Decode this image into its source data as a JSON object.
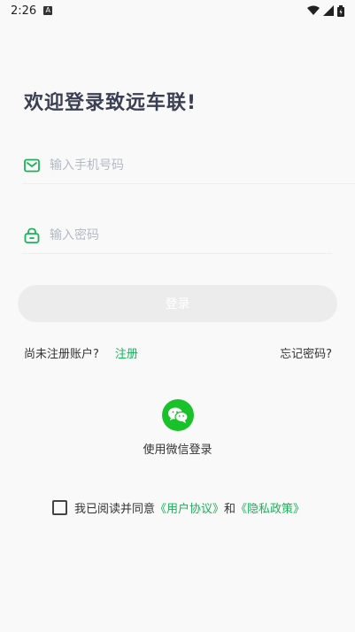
{
  "status_bar": {
    "time": "2:26",
    "notification_glyph": "A",
    "icons": [
      "wifi-icon",
      "signal-icon",
      "battery-icon"
    ]
  },
  "title": "欢迎登录致远车联!",
  "phone": {
    "placeholder": "输入手机号码",
    "value": "",
    "icon": "mail-icon"
  },
  "password": {
    "placeholder": "输入密码",
    "value": "",
    "icon": "lock-icon"
  },
  "login_button": "登录",
  "register": {
    "question": "尚未注册账户?",
    "register_link": "注册",
    "forgot": "忘记密码?"
  },
  "wechat": {
    "label": "使用微信登录",
    "icon": "wechat-icon"
  },
  "agreement": {
    "prefix": "我已阅读并同意",
    "user_agreement": "《用户协议》",
    "and": "和",
    "privacy_policy": "《隐私政策》",
    "checked": false
  },
  "colors": {
    "accent": "#19b35a",
    "wechat": "#19c22a",
    "title": "#3b3f52",
    "button_disabled": "#ececec"
  }
}
